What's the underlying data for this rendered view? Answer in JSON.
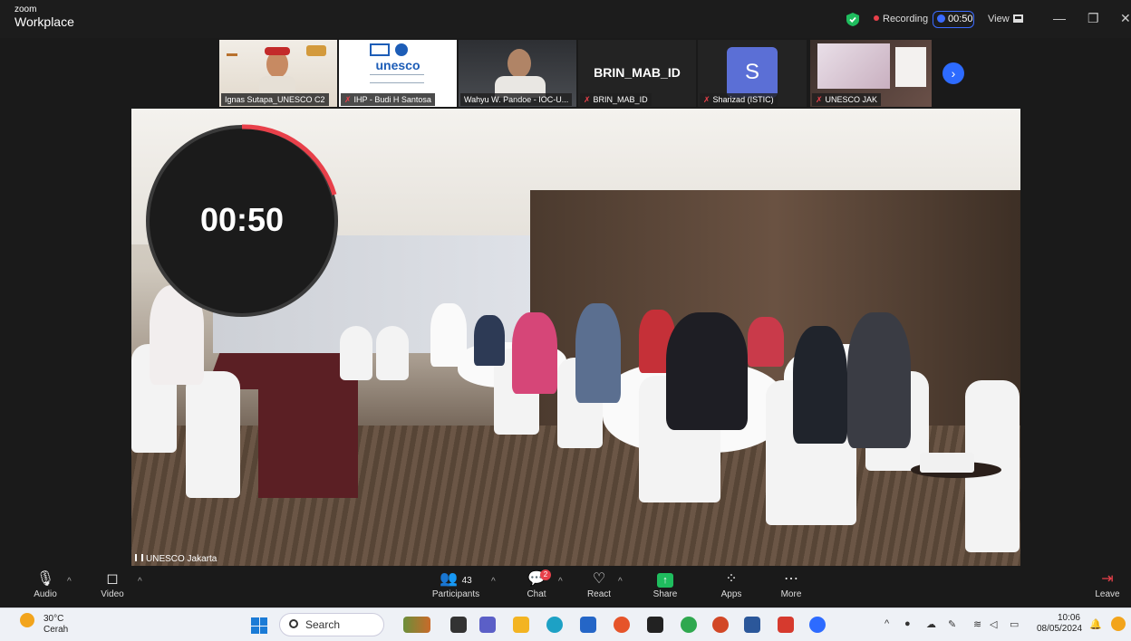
{
  "app": {
    "brand_small": "zoom",
    "brand_large": "Workplace"
  },
  "header": {
    "recording_label": "Recording",
    "timer": "00:50",
    "view_label": "View",
    "minimize": "—",
    "restore": "❐",
    "close": "✕"
  },
  "thumbnails": [
    {
      "name": "Ignas Sutapa_UNESCO C2",
      "muted": false
    },
    {
      "name": "IHP - Budi H Santosa",
      "muted": true,
      "logo_text": "unesco"
    },
    {
      "name": "Wahyu W. Pandoe - IOC-U...",
      "muted": false
    },
    {
      "name": "BRIN_MAB_ID",
      "muted": true,
      "heading": "BRIN_MAB_ID"
    },
    {
      "name": "Sharizad (ISTIC)",
      "muted": true,
      "avatar_letter": "S"
    },
    {
      "name": "UNESCO JAK",
      "muted": true
    }
  ],
  "main_video": {
    "label": "UNESCO Jakarta",
    "countdown": "00:50"
  },
  "toolbar": {
    "audio": "Audio",
    "video": "Video",
    "participants": "Participants",
    "participants_count": "43",
    "chat": "Chat",
    "chat_badge": "2",
    "react": "React",
    "share": "Share",
    "apps": "Apps",
    "more": "More",
    "leave": "Leave"
  },
  "taskbar": {
    "weather_temp": "30°C",
    "weather_desc": "Cerah",
    "search_label": "Search",
    "time": "10:06",
    "date": "08/05/2024"
  },
  "colors": {
    "accent_blue": "#2d6bff",
    "recording_red": "#e8404a",
    "share_green": "#1fbd5e"
  }
}
